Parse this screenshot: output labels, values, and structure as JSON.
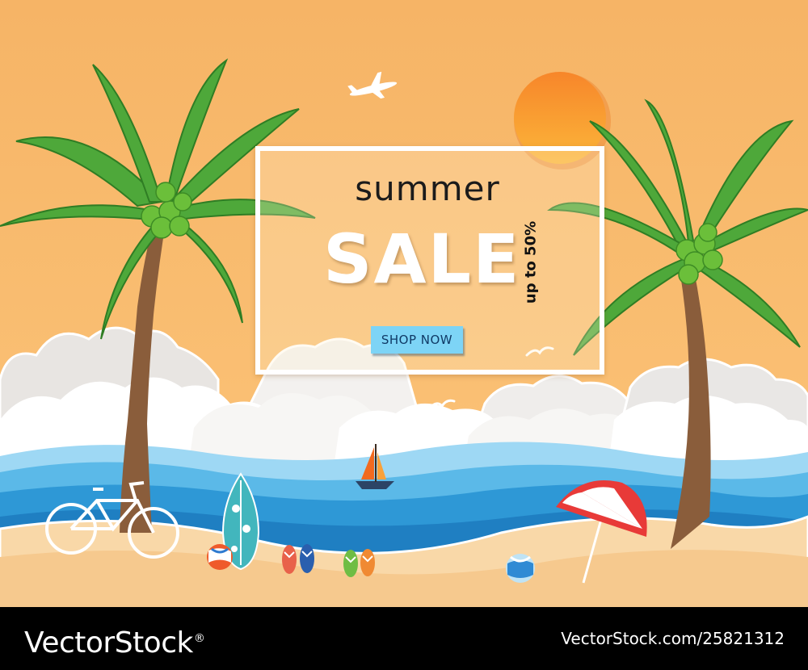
{
  "sign": {
    "heading": "summer",
    "sale": "SALE",
    "discount": "up to 50%",
    "button_label": "SHOP NOW"
  },
  "footer": {
    "brand": "VectorStock",
    "image_id": "VectorStock.com/25821312"
  },
  "palette": {
    "sky": "#fbb96a",
    "sun": "#f98f1f",
    "sea": "#2ea0dc",
    "sand": "#f6c98e",
    "palm_leaf": "#3fa133",
    "button": "#7dd4f6"
  }
}
